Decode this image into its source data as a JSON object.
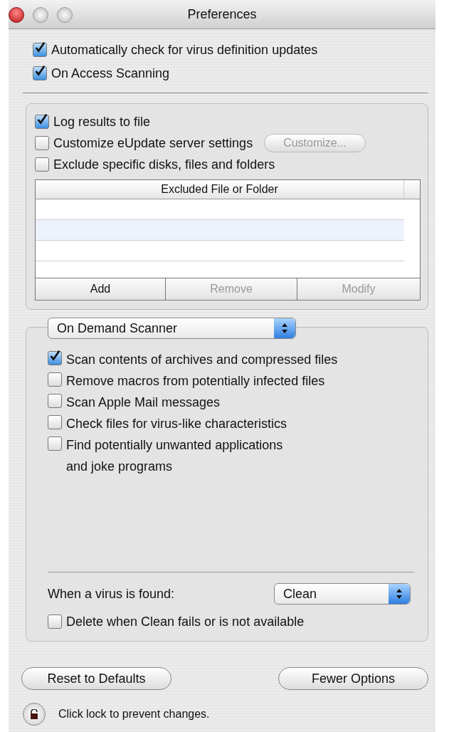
{
  "window": {
    "title": "Preferences"
  },
  "general": [
    {
      "label": "Automatically check for virus definition updates",
      "checked": true
    },
    {
      "label": "On Access Scanning",
      "checked": true
    }
  ],
  "options": [
    {
      "label": "Log results to file",
      "checked": true
    },
    {
      "label": "Customize eUpdate server settings",
      "checked": false,
      "button": {
        "label": "Customize...",
        "disabled": true
      }
    },
    {
      "label": "Exclude specific disks, files and folders",
      "checked": false
    }
  ],
  "exclusions": {
    "columns": [
      "Excluded File or Folder"
    ],
    "buttons": [
      {
        "label": "Add",
        "disabled": false
      },
      {
        "label": "Remove",
        "disabled": true
      },
      {
        "label": "Modify",
        "disabled": true
      }
    ]
  },
  "scanner": {
    "popup": "On Demand Scanner",
    "options": [
      {
        "label": "Scan contents of archives and compressed files",
        "checked": true
      },
      {
        "label": "Remove macros from potentially infected files",
        "checked": false
      },
      {
        "label": "Scan Apple Mail messages",
        "checked": false
      },
      {
        "label": "Check files for virus-like characteristics",
        "checked": false
      },
      {
        "label": "Find potentially unwanted applications\nand joke programs",
        "checked": false
      }
    ],
    "action_label": "When a virus is found:",
    "action": "Clean",
    "delete_option": {
      "label": "Delete when Clean fails or is not available",
      "checked": false
    }
  },
  "buttons": [
    "Reset to Defaults",
    "Fewer Options"
  ],
  "lock": {
    "text": "Click lock to prevent changes."
  }
}
